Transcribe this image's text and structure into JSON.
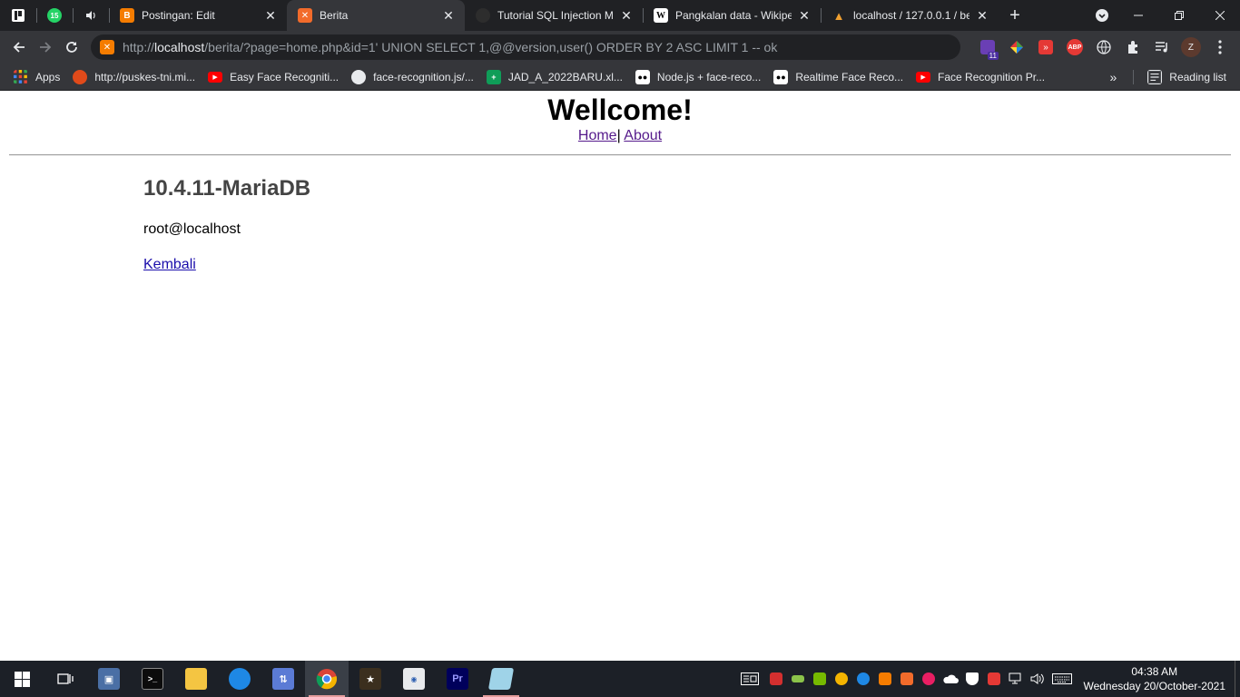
{
  "browser": {
    "tabs": [
      {
        "title": "Postingan: Edit",
        "favicon": "blogger-icon",
        "color": "#f57c00",
        "glyph": "B"
      },
      {
        "title": "Berita",
        "favicon": "xampp-icon",
        "color": "#f26b2b",
        "glyph": "X",
        "active": true
      },
      {
        "title": "Tutorial SQL Injection Ma",
        "favicon": "github-icon",
        "color": "#24292e",
        "glyph": "●"
      },
      {
        "title": "Pangkalan data - Wikipe",
        "favicon": "wikipedia-icon",
        "color": "#ffffff",
        "glyph": "W"
      },
      {
        "title": "localhost / 127.0.0.1 / be",
        "favicon": "phpmyadmin-icon",
        "color": "#f0a030",
        "glyph": "▲"
      }
    ],
    "pinned_badge": "15",
    "url": {
      "scheme": "http://",
      "host": "localhost",
      "path": "/berita/?page=home.php&id=1' UNION SELECT 1,@@version,user() ORDER BY 2 ASC LIMIT 1 -- ok"
    },
    "extension_badge": "11",
    "profile_initial": "Z",
    "bookmarks": [
      {
        "label": "Apps",
        "icon": "apps-grid-icon",
        "color": "#4285f4"
      },
      {
        "label": "http://puskes-tni.mi...",
        "icon": "puskes-icon",
        "color": "#e04a1a"
      },
      {
        "label": "Easy Face Recogniti...",
        "icon": "youtube-icon",
        "color": "#ff0000"
      },
      {
        "label": "face-recognition.js/...",
        "icon": "github-icon",
        "color": "#24292e"
      },
      {
        "label": "JAD_A_2022BARU.xl...",
        "icon": "sheets-icon",
        "color": "#0f9d58"
      },
      {
        "label": "Node.js + face-reco...",
        "icon": "medium-icon",
        "color": "#000000"
      },
      {
        "label": "Realtime Face Reco...",
        "icon": "medium-icon",
        "color": "#000000"
      },
      {
        "label": "Face Recognition Pr...",
        "icon": "youtube-icon",
        "color": "#ff0000"
      }
    ],
    "reading_list": "Reading list"
  },
  "page": {
    "title": "Wellcome!",
    "nav": {
      "home": "Home",
      "separator": "| ",
      "about": "About"
    },
    "result_heading": "10.4.11-MariaDB",
    "result_user": "root@localhost",
    "back_link": "Kembali"
  },
  "taskbar": {
    "time": "04:38 AM",
    "date": "Wednesday 20/October-2021"
  }
}
